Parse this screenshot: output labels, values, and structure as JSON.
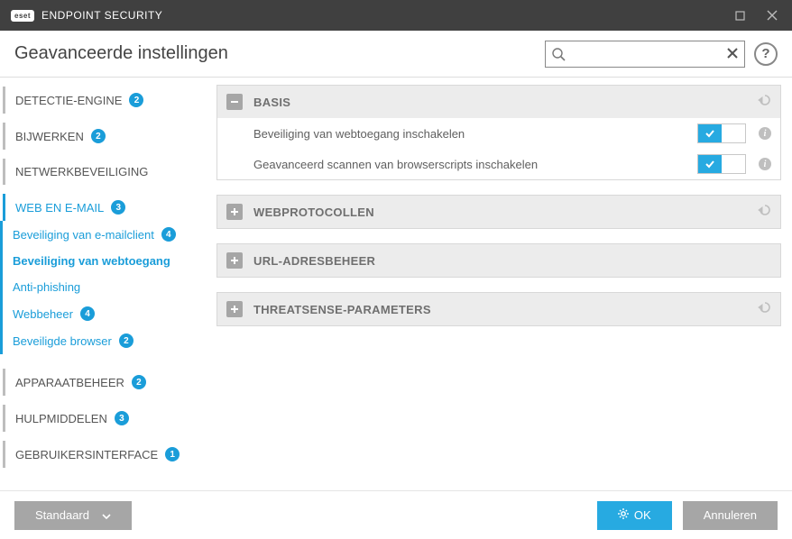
{
  "titlebar": {
    "brand": "ENDPOINT SECURITY",
    "logo": "eset"
  },
  "header": {
    "title": "Geavanceerde instellingen",
    "search_placeholder": "",
    "help_glyph": "?"
  },
  "sidebar": {
    "items": [
      {
        "label": "DETECTIE-ENGINE",
        "badge": "2",
        "type": "section"
      },
      {
        "label": "BIJWERKEN",
        "badge": "2",
        "type": "section"
      },
      {
        "label": "NETWERKBEVEILIGING",
        "badge": null,
        "type": "section"
      },
      {
        "label": "WEB EN E-MAIL",
        "badge": "3",
        "type": "section-active"
      },
      {
        "label": "Beveiliging van e-mailclient",
        "badge": "4",
        "type": "sub"
      },
      {
        "label": "Beveiliging van webtoegang",
        "badge": null,
        "type": "sub-active"
      },
      {
        "label": "Anti-phishing",
        "badge": null,
        "type": "sub"
      },
      {
        "label": "Webbeheer",
        "badge": "4",
        "type": "sub"
      },
      {
        "label": "Beveiligde browser",
        "badge": "2",
        "type": "sub"
      },
      {
        "label": "APPARAATBEHEER",
        "badge": "2",
        "type": "section"
      },
      {
        "label": "HULPMIDDELEN",
        "badge": "3",
        "type": "section"
      },
      {
        "label": "GEBRUIKERSINTERFACE",
        "badge": "1",
        "type": "section"
      }
    ]
  },
  "panels": [
    {
      "title": "BASIS",
      "expanded": true,
      "settings": [
        {
          "label": "Beveiliging van webtoegang inschakelen",
          "enabled": true
        },
        {
          "label": "Geavanceerd scannen van browserscripts inschakelen",
          "enabled": true
        }
      ]
    },
    {
      "title": "WEBPROTOCOLLEN",
      "expanded": false
    },
    {
      "title": "URL-ADRESBEHEER",
      "expanded": false
    },
    {
      "title": "THREATSENSE-PARAMETERS",
      "expanded": false
    }
  ],
  "footer": {
    "default_label": "Standaard",
    "ok_label": "OK",
    "cancel_label": "Annuleren"
  },
  "colors": {
    "accent": "#27aae1",
    "link": "#1a9dd9"
  }
}
